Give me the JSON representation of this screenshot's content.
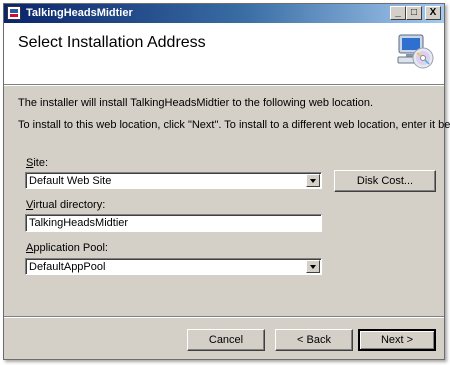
{
  "window": {
    "title": "TalkingHeadsMidtier",
    "controls": {
      "minimize": "_",
      "maximize": "□",
      "close": "X"
    }
  },
  "header": {
    "title": "Select Installation Address",
    "icon": "computer-cd-icon"
  },
  "intro": {
    "line1": "The installer will install TalkingHeadsMidtier to the following web location.",
    "line2": "To install to this web location, click \"Next\". To install to a different web location, enter it below."
  },
  "site": {
    "label_prefix": "",
    "label_underline": "S",
    "label_rest": "ite:",
    "value": "Default Web Site"
  },
  "disk_cost_button": "Disk Cost...",
  "virtual_directory": {
    "label_underline": "V",
    "label_rest": "irtual directory:",
    "value": "TalkingHeadsMidtier"
  },
  "app_pool": {
    "label_underline": "A",
    "label_rest": "pplication Pool:",
    "value": "DefaultAppPool"
  },
  "footer": {
    "cancel": "Cancel",
    "back": "< Back",
    "next": "Next >"
  }
}
